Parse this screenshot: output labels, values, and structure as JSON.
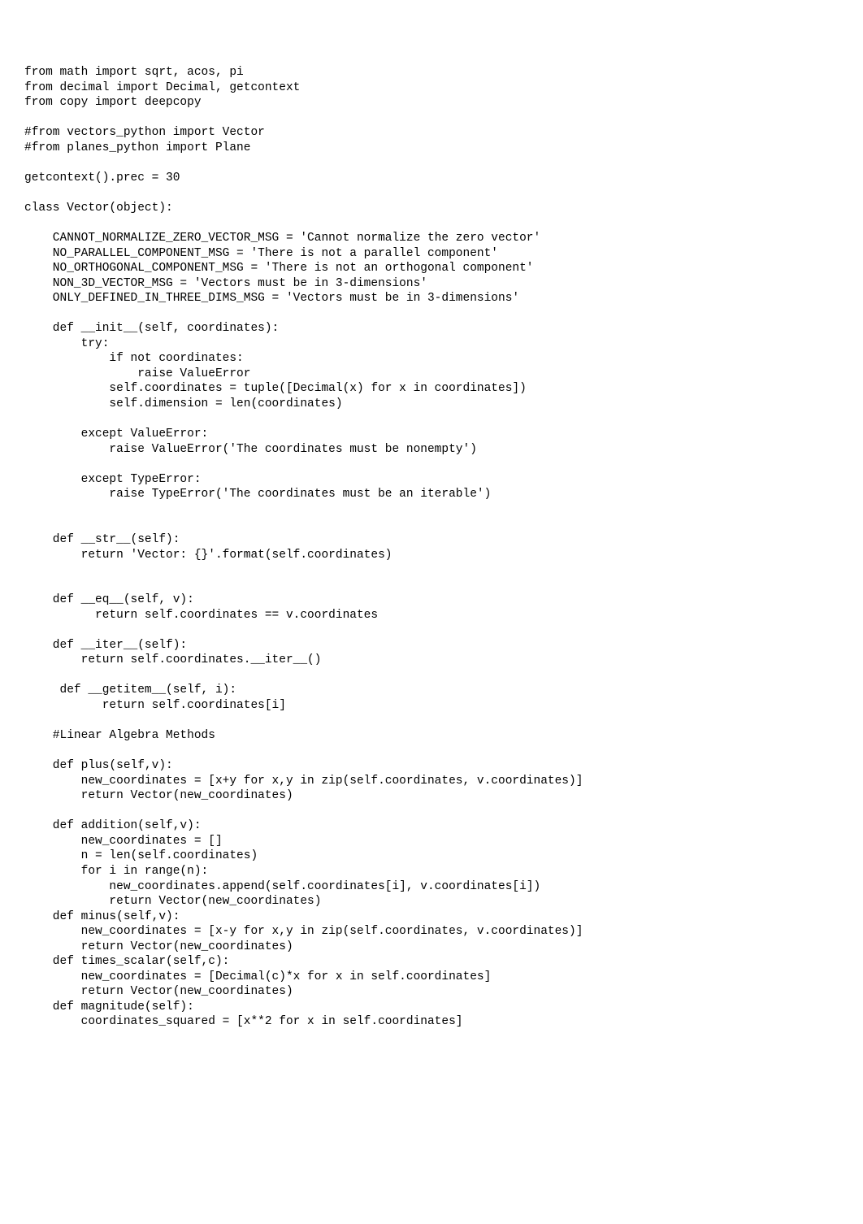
{
  "code": {
    "lines": [
      "from math import sqrt, acos, pi",
      "from decimal import Decimal, getcontext",
      "from copy import deepcopy",
      "",
      "#from vectors_python import Vector",
      "#from planes_python import Plane",
      "",
      "getcontext().prec = 30",
      "",
      "class Vector(object):",
      "",
      "    CANNOT_NORMALIZE_ZERO_VECTOR_MSG = 'Cannot normalize the zero vector'",
      "    NO_PARALLEL_COMPONENT_MSG = 'There is not a parallel component'",
      "    NO_ORTHOGONAL_COMPONENT_MSG = 'There is not an orthogonal component'",
      "    NON_3D_VECTOR_MSG = 'Vectors must be in 3-dimensions'",
      "    ONLY_DEFINED_IN_THREE_DIMS_MSG = 'Vectors must be in 3-dimensions'",
      "",
      "    def __init__(self, coordinates):",
      "        try:",
      "            if not coordinates:",
      "                raise ValueError",
      "            self.coordinates = tuple([Decimal(x) for x in coordinates])",
      "            self.dimension = len(coordinates)",
      "",
      "        except ValueError:",
      "            raise ValueError('The coordinates must be nonempty')",
      "",
      "        except TypeError:",
      "            raise TypeError('The coordinates must be an iterable')",
      "",
      "",
      "    def __str__(self):",
      "        return 'Vector: {}'.format(self.coordinates)",
      "",
      "",
      "    def __eq__(self, v):",
      "          return self.coordinates == v.coordinates",
      "",
      "    def __iter__(self):",
      "        return self.coordinates.__iter__()",
      "",
      "     def __getitem__(self, i):",
      "           return self.coordinates[i]",
      "",
      "    #Linear Algebra Methods",
      "",
      "    def plus(self,v):",
      "        new_coordinates = [x+y for x,y in zip(self.coordinates, v.coordinates)]",
      "        return Vector(new_coordinates)",
      "",
      "    def addition(self,v):",
      "        new_coordinates = []",
      "        n = len(self.coordinates)",
      "        for i in range(n):",
      "            new_coordinates.append(self.coordinates[i], v.coordinates[i])",
      "            return Vector(new_coordinates)",
      "    def minus(self,v):",
      "        new_coordinates = [x-y for x,y in zip(self.coordinates, v.coordinates)]",
      "        return Vector(new_coordinates)",
      "    def times_scalar(self,c):",
      "        new_coordinates = [Decimal(c)*x for x in self.coordinates]",
      "        return Vector(new_coordinates)",
      "    def magnitude(self):",
      "        coordinates_squared = [x**2 for x in self.coordinates]"
    ]
  }
}
